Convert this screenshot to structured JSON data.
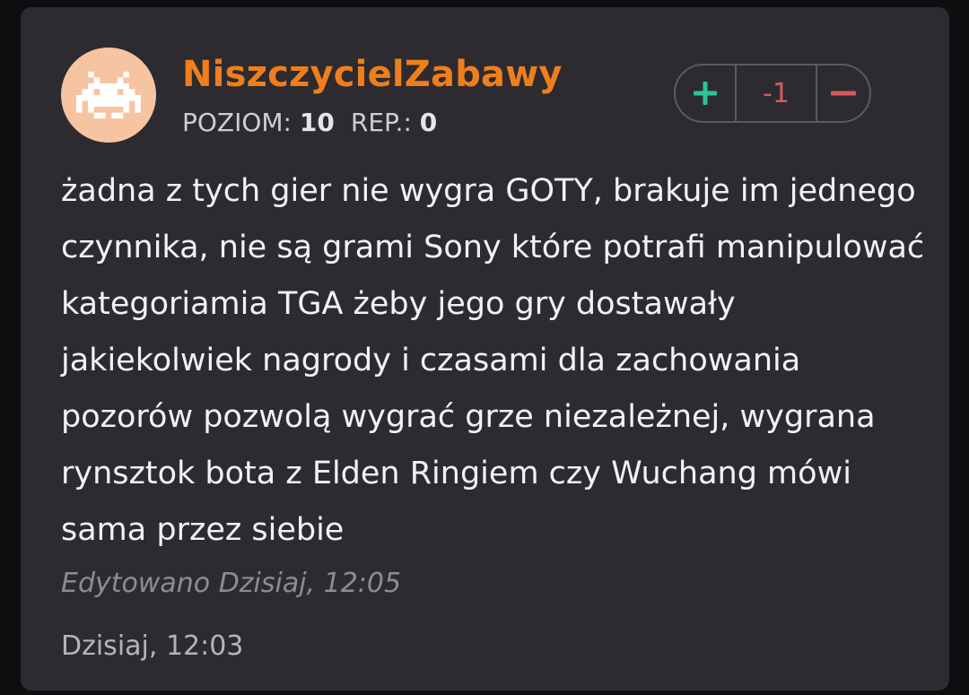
{
  "comment": {
    "author": "NiszczycielZabawy",
    "avatar_icon": "space-invader-icon",
    "level_label": "POZIOM:",
    "level_value": "10",
    "rep_label": "REP.:",
    "rep_value": "0",
    "vote": {
      "upvote_icon": "plus-icon",
      "score": "-1",
      "downvote_icon": "minus-icon"
    },
    "text": "żadna z tych gier nie wygra GOTY, brakuje im jednego czynnika, nie są grami Sony które potrafi manipulować kategoriamia TGA żeby jego gry dostawały jakiekolwiek nagrody i czasami dla zachowania pozorów pozwolą wygrać grze niezależnej, wygrana rynsztok bota z Elden Ringiem czy Wuchang mówi sama przez siebie",
    "edited": "Edytowano Dzisiaj, 12:05",
    "date": "Dzisiaj, 12:03"
  },
  "colors": {
    "username": "#ee7f1c",
    "upvote": "#2fc29a",
    "downvote": "#d35c5c",
    "avatar_bg": "#f6c4a0"
  }
}
